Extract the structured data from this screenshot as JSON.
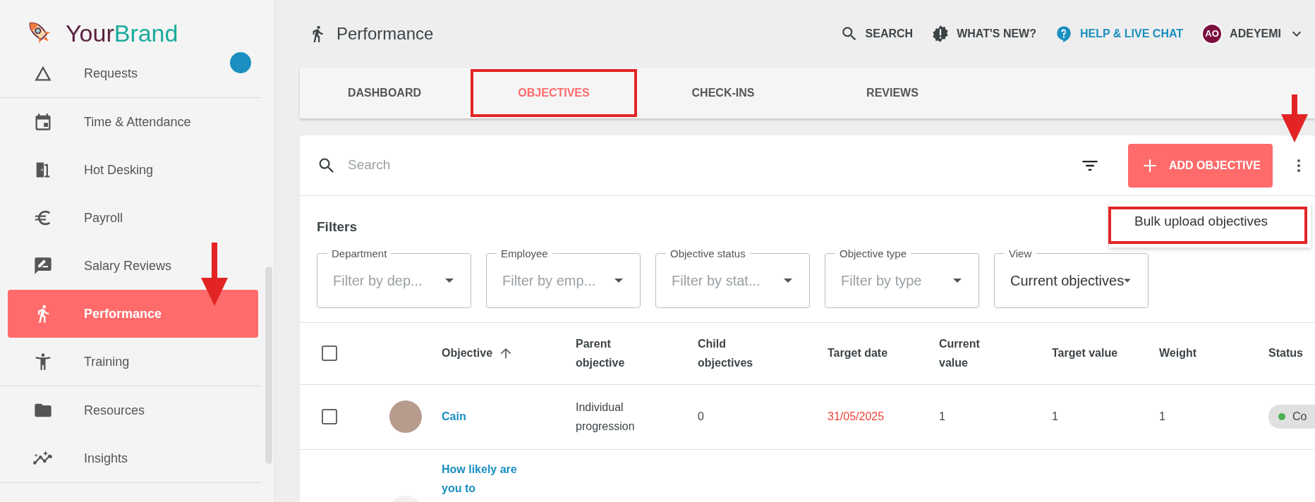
{
  "brand": {
    "part_1": "Your",
    "part_2": "Brand"
  },
  "sidebar": {
    "groups": [
      [
        {
          "label": "Requests",
          "kind": "requests",
          "selected": false,
          "badge": true
        }
      ],
      [
        {
          "label": "Time & Attendance",
          "kind": "calendar",
          "selected": false
        },
        {
          "label": "Hot Desking",
          "kind": "door",
          "selected": false
        },
        {
          "label": "Payroll",
          "kind": "euro",
          "selected": false
        },
        {
          "label": "Salary Reviews",
          "kind": "review",
          "selected": false
        },
        {
          "label": "Performance",
          "kind": "run",
          "selected": true
        },
        {
          "label": "Training",
          "kind": "person",
          "selected": false
        }
      ],
      [
        {
          "label": "Resources",
          "kind": "folder",
          "selected": false
        },
        {
          "label": "Insights",
          "kind": "insights",
          "selected": false
        }
      ]
    ]
  },
  "header": {
    "title": "Performance",
    "actions": [
      {
        "label": "SEARCH",
        "kind": "search"
      },
      {
        "label": "WHAT'S NEW?",
        "kind": "news"
      },
      {
        "label": "HELP & LIVE CHAT",
        "kind": "help"
      }
    ],
    "user": {
      "initials": "AO",
      "name": "ADEYEMI"
    }
  },
  "tabs": [
    {
      "label": "DASHBOARD",
      "selected": false,
      "outlined": false
    },
    {
      "label": "OBJECTIVES",
      "selected": true,
      "outlined": true
    },
    {
      "label": "CHECK-INS",
      "selected": false,
      "outlined": false
    },
    {
      "label": "REVIEWS",
      "selected": false,
      "outlined": false
    }
  ],
  "toolbar": {
    "search": {
      "placeholder": "Search"
    },
    "add_button": "ADD OBJECTIVE",
    "menu": [
      {
        "label": "Bulk upload objectives",
        "outlined": true
      }
    ]
  },
  "filters": {
    "title": "Filters",
    "fields": [
      {
        "label": "Department",
        "placeholder": "Filter by dep..."
      },
      {
        "label": "Employee",
        "placeholder": "Filter by emp..."
      },
      {
        "label": "Objective status",
        "placeholder": "Filter by stat..."
      },
      {
        "label": "Objective type",
        "placeholder": "Filter by type"
      },
      {
        "label": "View",
        "value": "Current objectives"
      }
    ]
  },
  "table": {
    "header_checked": false,
    "columns": [
      {
        "label": "Objective",
        "sorted": true
      },
      {
        "label": "Parent objective",
        "sorted": false
      },
      {
        "label": "Child objectives",
        "sorted": false
      },
      {
        "label": "Target date",
        "sorted": false
      },
      {
        "label": "Current value",
        "sorted": false
      },
      {
        "label": "Target value",
        "sorted": false
      },
      {
        "label": "Weight",
        "sorted": false
      },
      {
        "label": "Status",
        "sorted": false
      }
    ],
    "rows": [
      {
        "checked": false,
        "objective": "Cain",
        "parent": "Individual progression",
        "child": "0",
        "target_date": "31/05/2025",
        "overdue": true,
        "current": "1",
        "target": "1",
        "weight": "1",
        "status": "Co",
        "color": "#4caf50"
      },
      {
        "objective": "How likely are you to"
      }
    ]
  }
}
